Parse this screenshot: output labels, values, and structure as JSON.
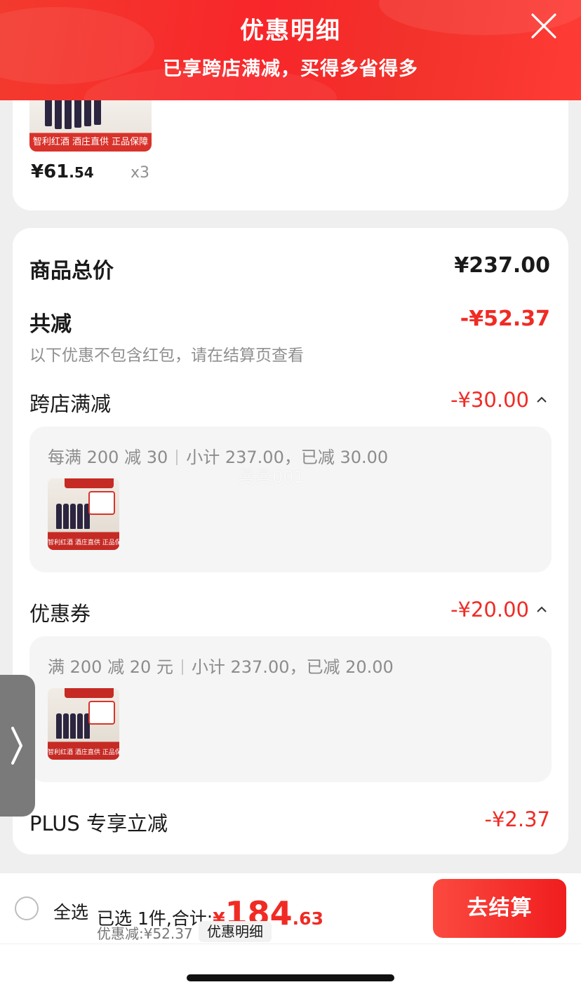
{
  "header": {
    "title": "优惠明细",
    "subtitle": "已享跨店满减，买得多省得多",
    "close_icon": "close-icon"
  },
  "top_item": {
    "thumb_band": "智利红酒 酒庄直供 正品保障",
    "price_symbol": "¥",
    "price_int": "61",
    "price_dec": ".54",
    "quantity": "x3"
  },
  "summary": {
    "total_label": "商品总价",
    "total_value": "¥237.00",
    "reduction_label": "共减",
    "reduction_value": "-¥52.37",
    "note": "以下优惠不包含红包，请在结算页查看"
  },
  "cross_store": {
    "label": "跨店满减",
    "value": "-¥30.00",
    "rule": "每满 200 减 30",
    "detail": "小计 237.00，已减 30.00",
    "thumb_band": "智利红酒 酒庄直供 正品保障"
  },
  "coupon": {
    "label": "优惠券",
    "value": "-¥20.00",
    "rule": "满 200 减 20 元",
    "detail": "小计 237.00，已减 20.00",
    "thumb_band": "智利红酒 酒庄直供 正品保障"
  },
  "plus": {
    "label": "PLUS 专享立减",
    "value": "-¥2.37"
  },
  "watermark": "曼曼001",
  "footer": {
    "select_all": "全选",
    "selected_text": "已选 1件,合计:",
    "total_yen": "¥",
    "total_int": "184",
    "total_dec": ".63",
    "discount_text": "优惠减:¥52.37",
    "detail_chip": "优惠明细",
    "checkout": "去结算"
  },
  "colors": {
    "accent_red": "#f02b24",
    "header_red": "#f8262a"
  }
}
